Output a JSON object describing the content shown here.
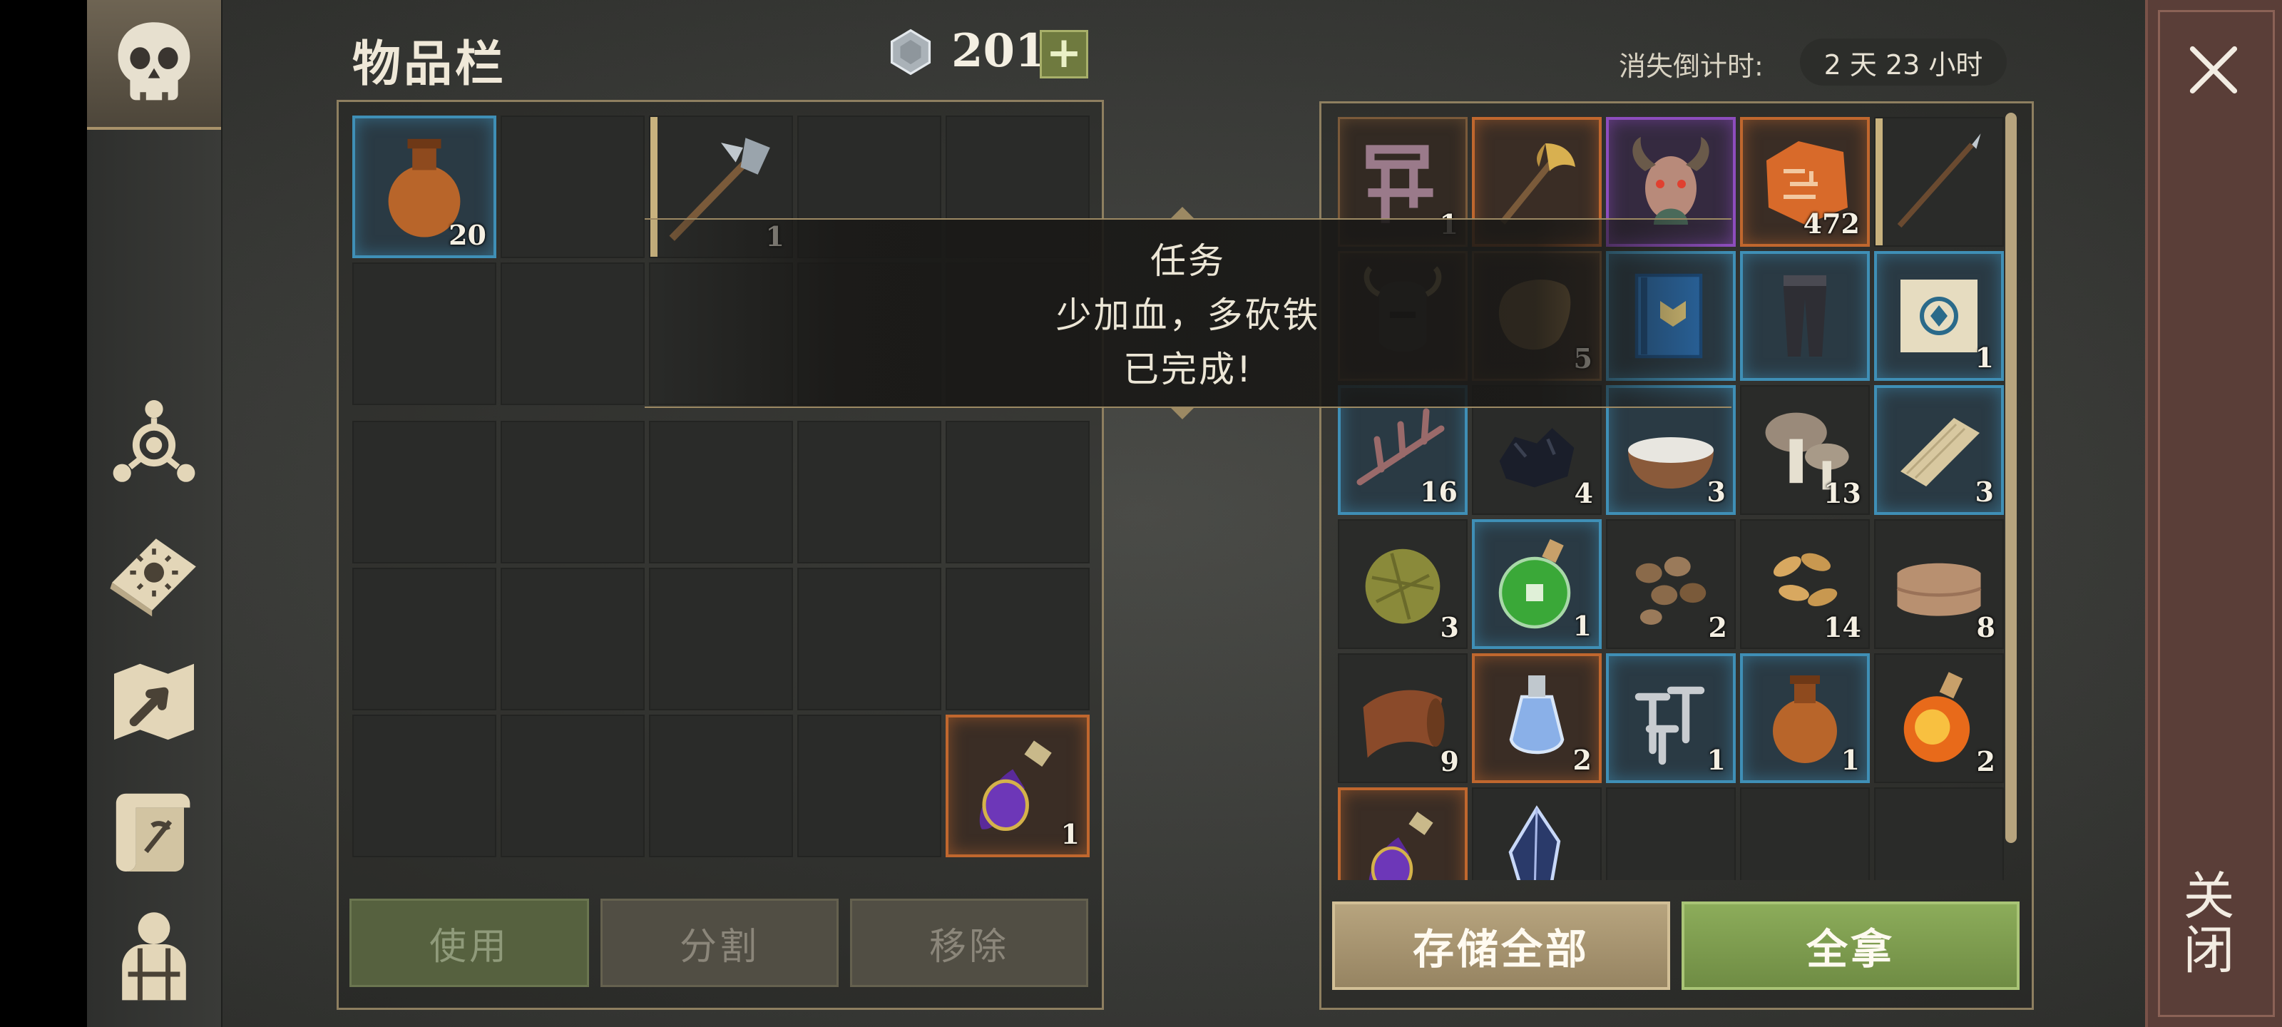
{
  "header": {
    "title": "物品栏",
    "currency_count": "201",
    "add_currency_label": "+",
    "countdown_label": "消失倒计时:",
    "countdown_value": "2 天 23 小时"
  },
  "sidebar": {
    "items": [
      {
        "name": "inventory-skull",
        "icon": "skull-icon",
        "active": true
      },
      {
        "name": "skills",
        "icon": "node-tree-icon"
      },
      {
        "name": "recipes",
        "icon": "sun-book-icon"
      },
      {
        "name": "map",
        "icon": "map-arrow-icon"
      },
      {
        "name": "quests",
        "icon": "scroll-icon"
      },
      {
        "name": "character",
        "icon": "character-icon"
      }
    ]
  },
  "close": {
    "label": "关闭",
    "icon": "close-x-icon"
  },
  "player_inventory": {
    "quick_slots": [
      {
        "icon": "water-jug-icon",
        "count": "20",
        "quality": "blue"
      },
      {
        "icon": "",
        "count": ""
      },
      {
        "icon": "halberd-icon",
        "count": "1",
        "quality": "none",
        "has_durability": true
      },
      {
        "icon": "",
        "count": ""
      },
      {
        "icon": "",
        "count": ""
      },
      {
        "icon": "",
        "count": ""
      },
      {
        "icon": "",
        "count": ""
      },
      {
        "icon": "",
        "count": ""
      },
      {
        "icon": "",
        "count": ""
      },
      {
        "icon": "",
        "count": ""
      }
    ],
    "bag_slots": [
      {
        "icon": "",
        "count": ""
      },
      {
        "icon": "",
        "count": ""
      },
      {
        "icon": "",
        "count": ""
      },
      {
        "icon": "",
        "count": ""
      },
      {
        "icon": "",
        "count": ""
      },
      {
        "icon": "",
        "count": ""
      },
      {
        "icon": "",
        "count": ""
      },
      {
        "icon": "",
        "count": ""
      },
      {
        "icon": "",
        "count": ""
      },
      {
        "icon": "",
        "count": ""
      },
      {
        "icon": "",
        "count": ""
      },
      {
        "icon": "",
        "count": ""
      },
      {
        "icon": "",
        "count": ""
      },
      {
        "icon": "",
        "count": ""
      },
      {
        "icon": "purple-potion-icon",
        "count": "1",
        "quality": "orange"
      }
    ]
  },
  "actions": {
    "use": "使用",
    "split": "分割",
    "remove": "移除"
  },
  "storage": {
    "slots": [
      {
        "icon": "crossbow-frame-icon",
        "count": "1",
        "quality": "bronze"
      },
      {
        "icon": "axe-icon",
        "count": "",
        "quality": "orange"
      },
      {
        "icon": "horned-mask-icon",
        "count": "",
        "quality": "purple"
      },
      {
        "icon": "rune-stone-icon",
        "count": "472",
        "quality": "orange"
      },
      {
        "icon": "spear-icon",
        "count": "",
        "quality": "none",
        "has_durability": true
      },
      {
        "icon": "horned-helmet-icon",
        "count": "",
        "quality": "bronze"
      },
      {
        "icon": "leather-scrap-icon",
        "count": "5",
        "quality": "bronze"
      },
      {
        "icon": "blue-book-icon",
        "count": "",
        "quality": "blue"
      },
      {
        "icon": "leg-armor-icon",
        "count": "",
        "quality": "blue"
      },
      {
        "icon": "rune-scroll-icon",
        "count": "1",
        "quality": "blue"
      },
      {
        "icon": "antler-icon",
        "count": "16",
        "quality": "blue"
      },
      {
        "icon": "coal-icon",
        "count": "4",
        "quality": "none"
      },
      {
        "icon": "flour-bowl-icon",
        "count": "3",
        "quality": "blue"
      },
      {
        "icon": "mushrooms-icon",
        "count": "13",
        "quality": "none"
      },
      {
        "icon": "wood-plank-icon",
        "count": "3",
        "quality": "blue"
      },
      {
        "icon": "grass-ball-icon",
        "count": "3",
        "quality": "none"
      },
      {
        "icon": "green-potion-icon",
        "count": "1",
        "quality": "blue"
      },
      {
        "icon": "seeds-icon",
        "count": "2",
        "quality": "none"
      },
      {
        "icon": "wheat-grains-icon",
        "count": "14",
        "quality": "none"
      },
      {
        "icon": "cloth-icon",
        "count": "8",
        "quality": "none"
      },
      {
        "icon": "leather-roll-icon",
        "count": "9",
        "quality": "none"
      },
      {
        "icon": "crystal-vial-icon",
        "count": "2",
        "quality": "orange"
      },
      {
        "icon": "iron-nails-icon",
        "count": "1",
        "quality": "blue"
      },
      {
        "icon": "water-jug-icon",
        "count": "1",
        "quality": "blue"
      },
      {
        "icon": "fire-flask-icon",
        "count": "2",
        "quality": "none"
      },
      {
        "icon": "purple-potion-icon",
        "count": "",
        "quality": "orange"
      },
      {
        "icon": "crystal-shard-icon",
        "count": "",
        "quality": "none"
      },
      {
        "icon": "",
        "count": ""
      },
      {
        "icon": "",
        "count": ""
      },
      {
        "icon": "",
        "count": ""
      }
    ]
  },
  "storage_actions": {
    "store_all": "存储全部",
    "take_all": "全拿"
  },
  "toast": {
    "line1": "任务",
    "line2": "少加血，多砍铁",
    "line3": "已完成!"
  },
  "colors": {
    "quality_blue": "#3f8fb6",
    "quality_orange": "#c0672e",
    "quality_purple": "#8d4dbd",
    "take_all_green": "#7f9c4f",
    "store_tan": "#a8956e",
    "close_panel": "#5a3e38"
  }
}
